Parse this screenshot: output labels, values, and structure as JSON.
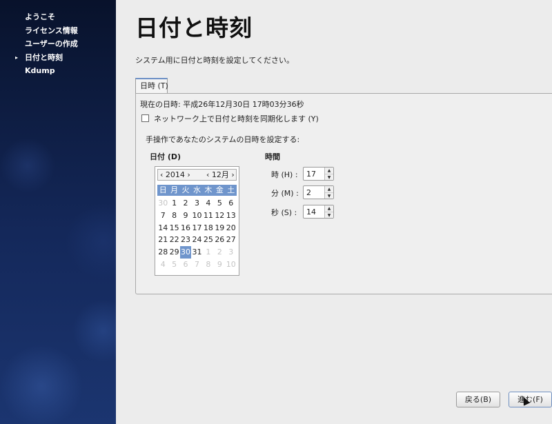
{
  "sidebar": {
    "items": [
      {
        "label": "ようこそ",
        "current": false
      },
      {
        "label": "ライセンス情報",
        "current": false
      },
      {
        "label": "ユーザーの作成",
        "current": false
      },
      {
        "label": "日付と時刻",
        "current": true
      },
      {
        "label": "Kdump",
        "current": false
      }
    ],
    "arrow_glyph": "▸"
  },
  "main": {
    "title": "日付と時刻",
    "description": "システム用に日付と時刻を設定してください。",
    "tab_label": "日時 (T)",
    "current_datetime": "現在の日時:  平成26年12月30日 17時03分36秒",
    "sync_label": "ネットワーク上で日付と時刻を同期化します (Y)",
    "sync_checked": false,
    "manual_label": "手操作であなたのシステムの日時を設定する:",
    "date_label": "日付 (D)",
    "time_label": "時間"
  },
  "calendar": {
    "year": "‹ 2014 ›",
    "month": "‹ 12月 ›",
    "weekdays": [
      "日",
      "月",
      "火",
      "水",
      "木",
      "金",
      "土"
    ],
    "header_color": "#6f95cc",
    "selected_day": "30",
    "rows": [
      [
        "30",
        "1",
        "2",
        "3",
        "4",
        "5",
        "6"
      ],
      [
        "7",
        "8",
        "9",
        "10",
        "11",
        "12",
        "13"
      ],
      [
        "14",
        "15",
        "16",
        "17",
        "18",
        "19",
        "20"
      ],
      [
        "21",
        "22",
        "23",
        "24",
        "25",
        "26",
        "27"
      ],
      [
        "28",
        "29",
        "30",
        "31",
        "1",
        "2",
        "3"
      ],
      [
        "4",
        "5",
        "6",
        "7",
        "8",
        "9",
        "10"
      ]
    ]
  },
  "time": {
    "hour_label": "時 (H) :",
    "hour_value": "17",
    "minute_label": "分 (M) :",
    "minute_value": "2",
    "second_label": "秒 (S) :",
    "second_value": "14"
  },
  "buttons": {
    "back": "戻る(B)",
    "next": "進む(F)"
  }
}
